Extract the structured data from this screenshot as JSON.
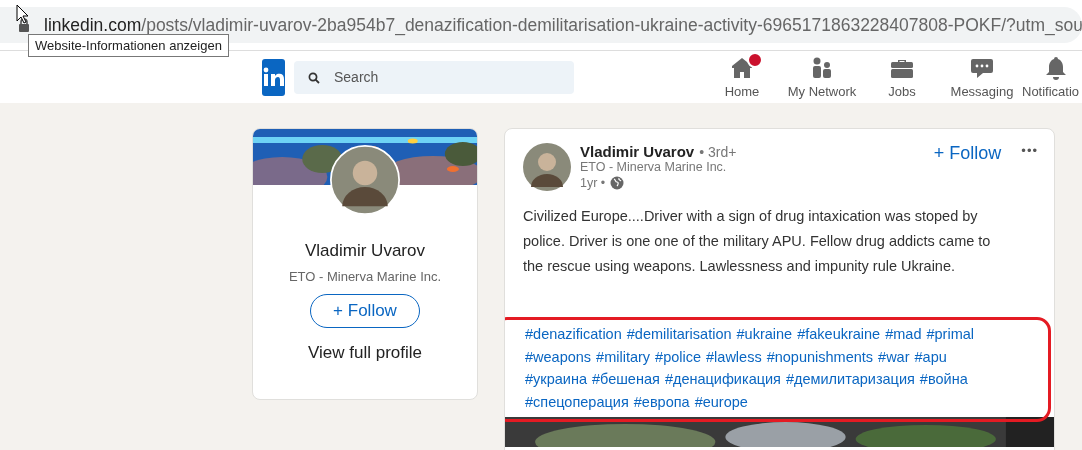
{
  "browser": {
    "url_host": "linkedin.com",
    "url_path": "/posts/vladimir-uvarov-2ba954b7_denazification-demilitarisation-ukraine-activity-6965171863228407808-POKF/?utm_sou",
    "tooltip": "Website-Informationen anzeigen"
  },
  "nav": {
    "search": {
      "placeholder": "Search"
    },
    "items": [
      {
        "label": "Home",
        "kind": "home",
        "badge": true
      },
      {
        "label": "My Network",
        "kind": "network",
        "badge": false
      },
      {
        "label": "Jobs",
        "kind": "jobs",
        "badge": false
      },
      {
        "label": "Messaging",
        "kind": "messaging",
        "badge": false
      },
      {
        "label": "Notificatio",
        "kind": "bell",
        "badge": false
      }
    ]
  },
  "profile_card": {
    "name": "Vladimir Uvarov",
    "headline": "ETO - Minerva Marine Inc.",
    "follow": "+ Follow",
    "view_profile": "View full profile"
  },
  "post": {
    "author": "Vladimir Uvarov",
    "degree": "• 3rd+",
    "headline": "ETO - Minerva Marine Inc.",
    "age": "1yr •",
    "follow": "+ Follow",
    "more": "•••",
    "text": "Civilized Europe....Driver with a sign of drug intaxication was stoped by police. Driver is one one of the military APU. Fellow drug addicts came to the rescue using weapons. Lawlessness and impunity rule Ukraine.",
    "hashtags": [
      "#denazification",
      "#demilitarisation",
      "#ukraine",
      "#fakeukraine",
      "#mad",
      "#primal",
      "#weapons",
      "#military",
      "#police",
      "#lawless",
      "#nopunishments",
      "#war",
      "#apu",
      "#украина",
      "#бешеная",
      "#денацификация",
      "#демилитаризация",
      "#война",
      "#спецоперация",
      "#европа",
      "#europe"
    ],
    "hashtags_highlighted": true
  }
}
